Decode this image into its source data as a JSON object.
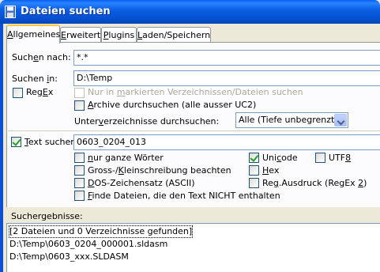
{
  "window": {
    "title": "Dateien suchen"
  },
  "tabs": [
    {
      "label": "Allgemeines",
      "u": "A",
      "rest": "llgemeines"
    },
    {
      "label": "Erweitert",
      "u": "E",
      "rest": "rweitert"
    },
    {
      "label": "Plugins",
      "u": "P",
      "rest": "lugins"
    },
    {
      "label": "Laden/Speichern",
      "u": "L",
      "rest": "aden/Speichern"
    }
  ],
  "search": {
    "name_label_pre": "Such",
    "name_label_u": "e",
    "name_label_post": "n nach:",
    "name_value": "*.*",
    "in_label_pre": "Suchen ",
    "in_label_u": "i",
    "in_label_post": "n:",
    "in_value": "D:\\Temp",
    "regex_pre": "Reg",
    "regex_u": "E",
    "regex_post": "x",
    "only_marked_pre": "Nur in ",
    "only_marked_u": "m",
    "only_marked_post": "arkierten Verzeichnissen/Dateien suchen",
    "archives_u": "A",
    "archives_post": "rchive durchsuchen (alle ausser UC2)",
    "subdirs_pre": "Unter",
    "subdirs_u": "v",
    "subdirs_post": "erzeichnisse durchsuchen:",
    "subdirs_value": "Alle (Tiefe unbegrenzt)"
  },
  "text": {
    "label_u": "T",
    "label_post": "ext suchen:",
    "value": "0603_0204_013",
    "whole_words_pre": "",
    "whole_words_u": "n",
    "whole_words_post": "ur ganze Wörter",
    "case_pre": "Gross-/",
    "case_u": "K",
    "case_post": "leinschreibung beachten",
    "dos_pre": "",
    "dos_u": "D",
    "dos_post": "OS-Zeichensatz (ASCII)",
    "not_containing_pre": "",
    "not_containing_u": "F",
    "not_containing_post": "inde Dateien, die den Text NICHT enthalten",
    "unicode_pre": "Uni",
    "unicode_u": "c",
    "unicode_post": "ode",
    "utf8_pre": "UTF",
    "utf8_u": "8",
    "utf8_post": "",
    "hex_pre": "",
    "hex_u": "H",
    "hex_post": "ex",
    "regex_pre": "Re",
    "regex_u": "g",
    "regex_post": ".Ausdruck (RegEx ",
    "regex_u2": "2",
    "regex_post2": ")"
  },
  "results": {
    "label": "Suchergebnisse:",
    "rows": [
      "[2 Dateien und 0 Verzeichnisse gefunden]",
      "D:\\Temp\\0603_0204_000001.sldasm",
      "D:\\Temp\\0603_xxx.SLDASM"
    ]
  },
  "colors": {
    "titlebar": "#0a5cf0",
    "active_tab_accent": "#ffc83c",
    "checkbox_check": "#21a121"
  }
}
